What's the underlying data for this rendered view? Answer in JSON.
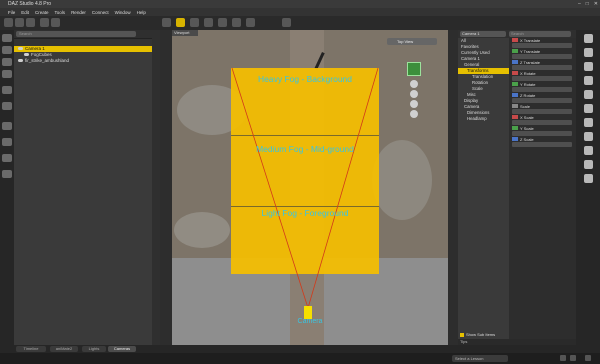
{
  "window": {
    "title": "DAZ Studio 4.8 Pro",
    "controls": [
      "–",
      "□",
      "✕"
    ]
  },
  "menu": [
    "File",
    "Edit",
    "Create",
    "Tools",
    "Render",
    "Connect",
    "Window",
    "Help"
  ],
  "toolbar": {
    "icons": [
      "new-icon",
      "open-icon",
      "save-icon",
      "undo-icon",
      "redo-icon",
      "select-icon",
      "universal-tool-icon",
      "rotate-icon",
      "translate-icon",
      "scale-icon",
      "joint-editor-icon",
      "node-weight-icon",
      "render-icon"
    ]
  },
  "scene": {
    "search_placeholder": "Search",
    "items": [
      {
        "label": "Camera 1",
        "selected": true
      },
      {
        "label": "FogCubes",
        "selected": false
      },
      {
        "label": "fir_strike_ambushland",
        "selected": false
      }
    ]
  },
  "viewport": {
    "tab_label": "Viewport",
    "view_label": "Top View",
    "fog_labels": {
      "heavy": "Heavy Fog - Background",
      "medium": "Medium Fog - Mid-ground",
      "light": "Light Fog - Foreground"
    },
    "camera_label": "Camera",
    "colors": {
      "fog": "#f5be00",
      "label": "#39c5e2",
      "frustum": "#d23a1a",
      "camera": "#f6e000"
    }
  },
  "parameters": {
    "node_label": "Camera 1",
    "search_placeholder": "Search",
    "tree": [
      {
        "label": "All",
        "selected": false
      },
      {
        "label": "Favorites",
        "selected": false
      },
      {
        "label": "Currently Used",
        "selected": false
      },
      {
        "label": "Camera 1",
        "selected": false
      },
      {
        "label": "General",
        "selected": false
      },
      {
        "label": "Transforms",
        "selected": true
      },
      {
        "label": "Translation",
        "selected": false
      },
      {
        "label": "Rotation",
        "selected": false
      },
      {
        "label": "Scale",
        "selected": false
      },
      {
        "label": "Misc",
        "selected": false
      },
      {
        "label": "Display",
        "selected": false
      },
      {
        "label": "Camera",
        "selected": false
      },
      {
        "label": "Dimensions",
        "selected": false
      },
      {
        "label": "Headlamp",
        "selected": false
      }
    ],
    "controls": [
      {
        "label": "X Translate",
        "value": "",
        "color": "#c74a4a"
      },
      {
        "label": "Y Translate",
        "value": "",
        "color": "#4aa04a"
      },
      {
        "label": "Z Translate",
        "value": "",
        "color": "#4a74c7"
      },
      {
        "label": "X Rotate",
        "value": "",
        "color": "#c74a4a"
      },
      {
        "label": "Y Rotate",
        "value": "",
        "color": "#4aa04a"
      },
      {
        "label": "Z Rotate",
        "value": "",
        "color": "#4a74c7"
      },
      {
        "label": "Scale",
        "value": "",
        "color": "#888888"
      },
      {
        "label": "X Scale",
        "value": "",
        "color": "#c74a4a"
      },
      {
        "label": "Y Scale",
        "value": "",
        "color": "#4aa04a"
      },
      {
        "label": "Z Scale",
        "value": "",
        "color": "#4a74c7"
      }
    ],
    "show_sub_items": "Show Sub Items",
    "tips": "Tips"
  },
  "bottom_tabs": [
    {
      "label": "Timeline",
      "active": false
    },
    {
      "label": "aniMate2",
      "active": false
    },
    {
      "label": "Lights",
      "active": false
    },
    {
      "label": "Cameras",
      "active": true
    }
  ],
  "status": {
    "lesson_placeholder": "Select a Lesson"
  }
}
